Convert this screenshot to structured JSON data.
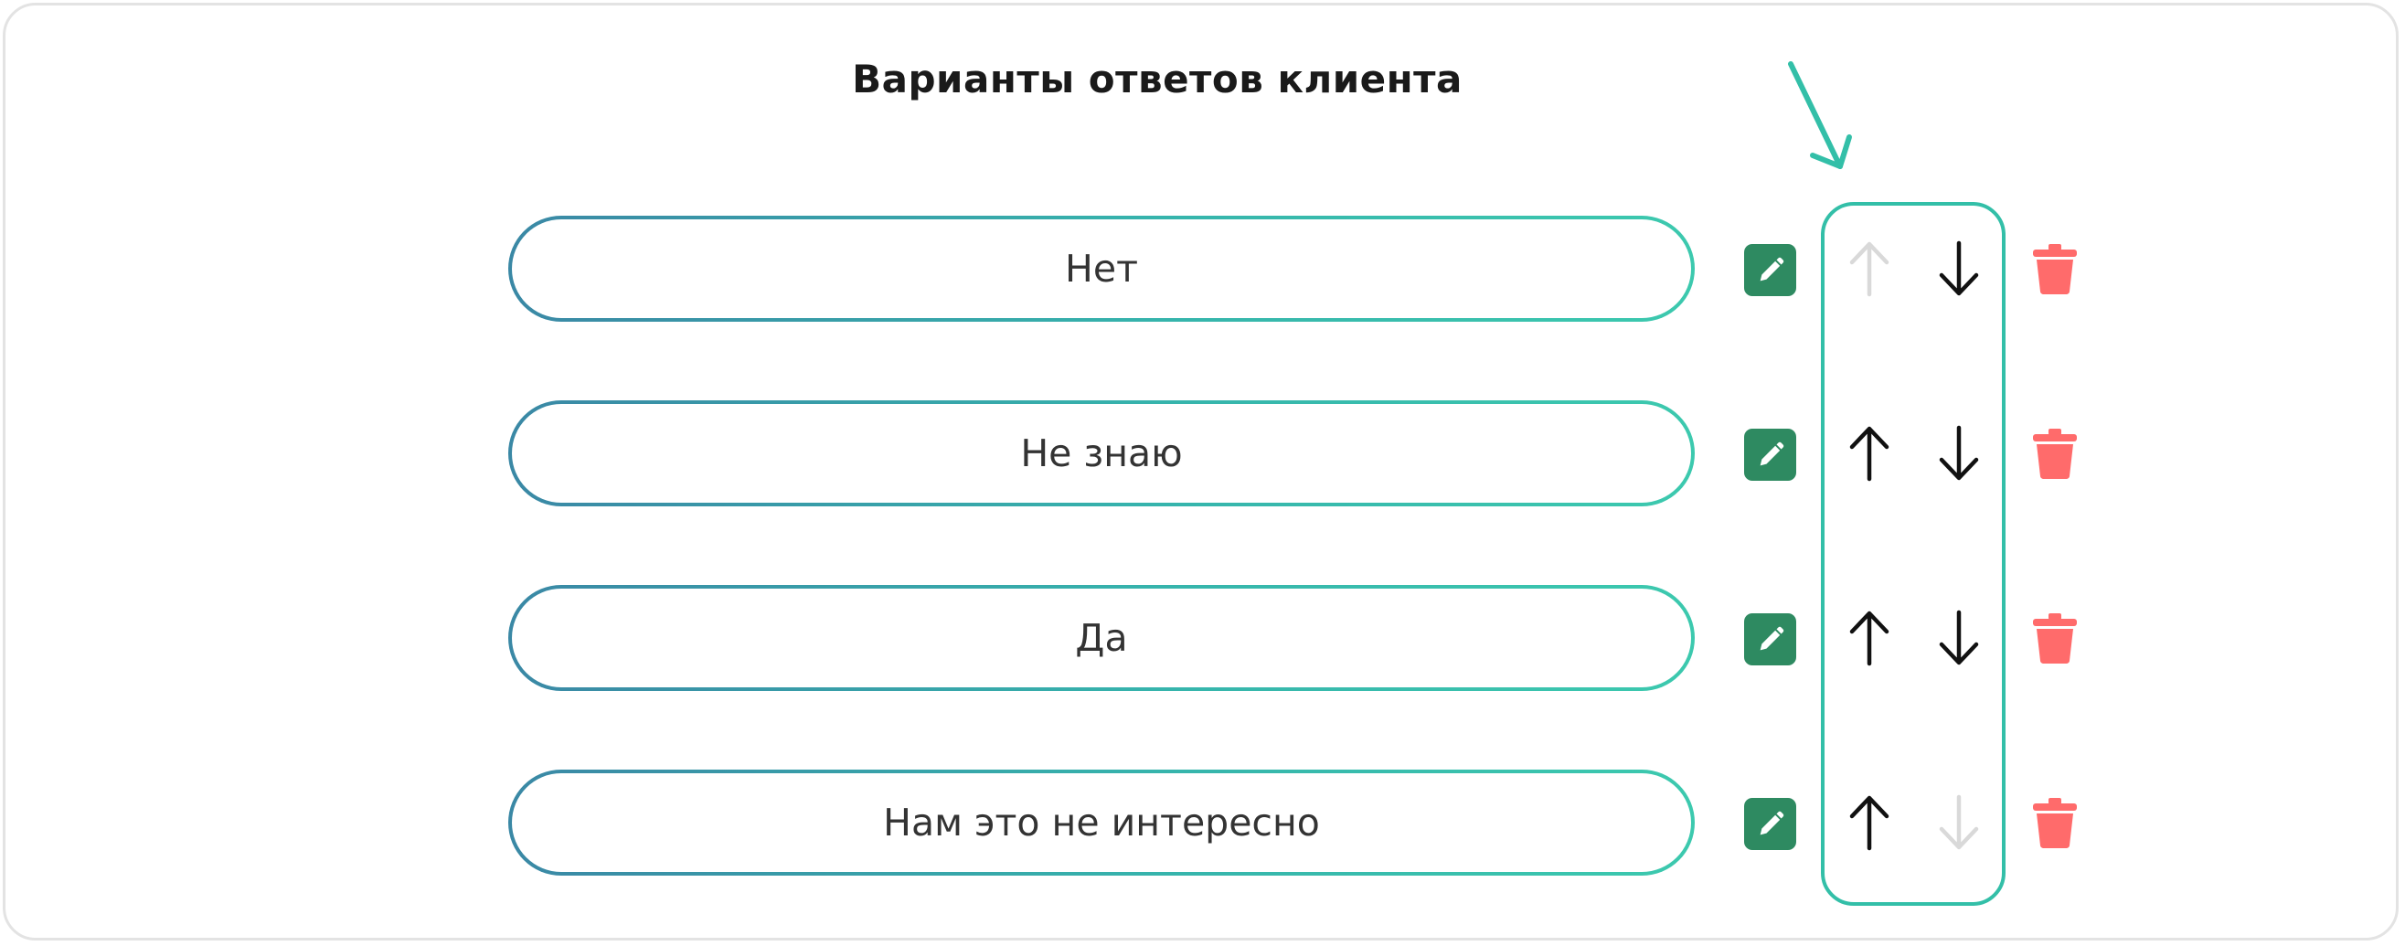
{
  "title": "Варианты ответов клиента",
  "colors": {
    "accent": "#33bfa8",
    "edit": "#2e8a61",
    "delete": "#ff6b6b",
    "arrow_active": "#111111",
    "arrow_disabled": "#d9d9d9"
  },
  "answers": [
    {
      "label": "Нет",
      "up_enabled": false,
      "down_enabled": true
    },
    {
      "label": "Не знаю",
      "up_enabled": true,
      "down_enabled": true
    },
    {
      "label": "Да",
      "up_enabled": true,
      "down_enabled": true
    },
    {
      "label": "Нам это не интересно",
      "up_enabled": true,
      "down_enabled": false
    }
  ],
  "icons": {
    "edit": "pencil-icon",
    "move_up": "arrow-up-icon",
    "move_down": "arrow-down-icon",
    "delete": "trash-icon",
    "pointer": "pointer-arrow-icon"
  }
}
